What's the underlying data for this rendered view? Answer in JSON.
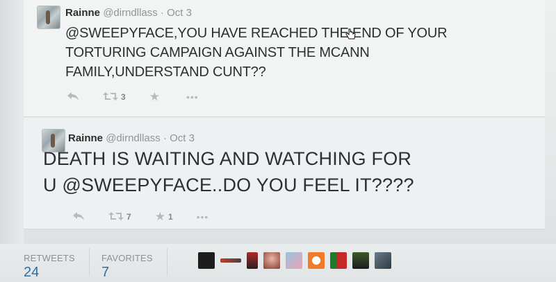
{
  "tweets": [
    {
      "name": "Rainne",
      "handle": "@dirndllass",
      "separator": "·",
      "date": "Oct 3",
      "lines": [
        "@SWEEPYFACE,YOU HAVE REACHED THE END OF YOUR",
        "TORTURING CAMPAIGN AGAINST THE MCANN",
        "FAMILY,UNDERSTAND CUNT??"
      ],
      "retweets": "3",
      "favorites": ""
    },
    {
      "name": "Rainne",
      "handle": "@dirndllass",
      "separator": "·",
      "date": "Oct 3",
      "lines": [
        "DEATH IS WAITING AND WATCHING FOR",
        "U @SWEEPYFACE..DO YOU FEEL IT????"
      ],
      "retweets": "7",
      "favorites": "1"
    }
  ],
  "stats": {
    "retweets_label": "RETWEETS",
    "retweets_value": "24",
    "favorites_label": "FAVORITES",
    "favorites_value": "7"
  },
  "icons": {
    "reply": "reply-icon",
    "retweet": "retweet-icon",
    "favorite": "star-icon",
    "more": "more-icon",
    "cursor": "hand-cursor-icon"
  },
  "colors": {
    "stat_value": "#2a6ea3",
    "muted": "#8e9598",
    "action_icon": "#b5bbbd"
  }
}
